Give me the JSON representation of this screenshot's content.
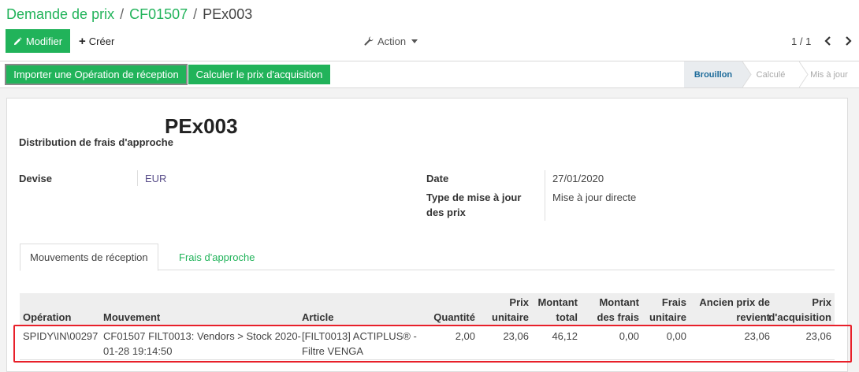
{
  "breadcrumb": {
    "item1": "Demande de prix",
    "item2": "CF01507",
    "current": "PEx003",
    "separator": "/"
  },
  "control": {
    "edit_label": "Modifier",
    "create_label": "Créer",
    "action_label": "Action",
    "pager_text": "1 / 1"
  },
  "statusbar": {
    "import_label": "Importer une Opération de réception",
    "compute_label": "Calculer le prix d'acquisition",
    "stages": [
      "Brouillon",
      "Calculé",
      "Mis à jour"
    ],
    "active_stage": "Brouillon"
  },
  "form": {
    "name": "PEx003",
    "subtitle": "Distribution de frais d'approche",
    "currency_label": "Devise",
    "currency_value": "EUR",
    "date_label": "Date",
    "date_value": "27/01/2020",
    "update_type_label_1": "Type de mise à jour",
    "update_type_label_2": "des prix",
    "update_type_value": "Mise à jour directe"
  },
  "tabs": [
    "Mouvements de réception",
    "Frais d'approche"
  ],
  "table": {
    "headers": {
      "operation": "Opération",
      "movement": "Mouvement",
      "article": "Article",
      "quantity": "Quantité",
      "unit_price_1": "Prix",
      "unit_price_2": "unitaire",
      "total_1": "Montant",
      "total_2": "total",
      "fees_1": "Montant",
      "fees_2": "des frais",
      "unit_fees_1": "Frais",
      "unit_fees_2": "unitaire",
      "old_cost_1": "Ancien prix de",
      "old_cost_2": "revient",
      "acq_price_1": "Prix",
      "acq_price_2": "d'acquisition"
    },
    "rows": [
      {
        "operation": "SPIDY\\IN\\00297",
        "movement_1": "CF01507 FILT0013: Vendors > Stock 2020-",
        "movement_2": "01-28 19:14:50",
        "article_1": "[FILT0013] ACTIPLUS® -",
        "article_2": "Filtre VENGA",
        "quantity": "2,00",
        "unit_price": "23,06",
        "total": "46,12",
        "fees": "0,00",
        "unit_fees": "0,00",
        "old_cost": "23,06",
        "acq_price": "23,06"
      }
    ]
  },
  "colors": {
    "accent": "#21b35a",
    "highlight": "#e8202a",
    "active_stage": "#1d6b9a"
  },
  "icons": {
    "edit": "pencil-icon",
    "create": "plus-icon",
    "action": "wrench-icon",
    "prev": "chevron-left-icon",
    "next": "chevron-right-icon"
  }
}
